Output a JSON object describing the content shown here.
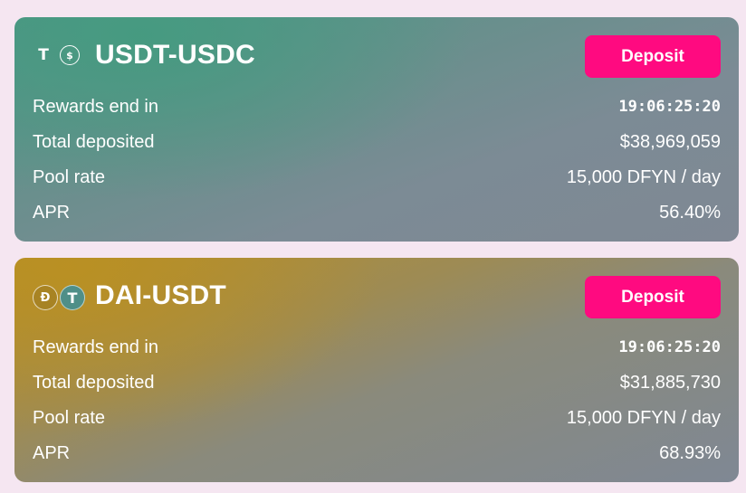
{
  "pools": [
    {
      "title": "USDT-USDC",
      "icons": [
        "tether-icon",
        "usdc-icon"
      ],
      "deposit_label": "Deposit",
      "rows": [
        {
          "label": "Rewards end in",
          "value": "19:06:25:20"
        },
        {
          "label": "Total deposited",
          "value": "$38,969,059"
        },
        {
          "label": "Pool rate",
          "value": "15,000 DFYN / day"
        },
        {
          "label": "APR",
          "value": "56.40%"
        }
      ],
      "accent": "#4e9586"
    },
    {
      "title": "DAI-USDT",
      "icons": [
        "dai-icon",
        "tether-icon"
      ],
      "deposit_label": "Deposit",
      "rows": [
        {
          "label": "Rewards end in",
          "value": "19:06:25:20"
        },
        {
          "label": "Total deposited",
          "value": "$31,885,730"
        },
        {
          "label": "Pool rate",
          "value": "15,000 DFYN / day"
        },
        {
          "label": "APR",
          "value": "68.93%"
        }
      ],
      "accent": "#b48e2c"
    }
  ],
  "colors": {
    "page_background": "#f5e6f1",
    "deposit_button": "#ff0a80"
  }
}
